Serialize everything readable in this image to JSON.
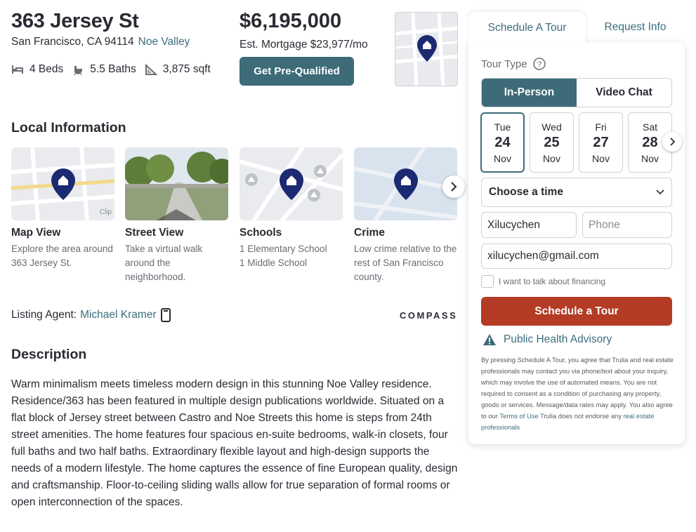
{
  "listing": {
    "street": "363 Jersey St",
    "city_state_zip": "San Francisco, CA 94114",
    "neighborhood": "Noe Valley",
    "beds": "4 Beds",
    "baths": "5.5 Baths",
    "sqft": "3,875 sqft",
    "price": "$6,195,000",
    "mortgage": "Est. Mortgage $23,977/mo",
    "prequal_button": "Get Pre-Qualified"
  },
  "local_info": {
    "heading": "Local Information",
    "map_clip_label": "Clip",
    "cards": [
      {
        "title": "Map View",
        "desc": "Explore the area around 363 Jersey St."
      },
      {
        "title": "Street View",
        "desc": "Take a virtual walk around the neighborhood."
      },
      {
        "title": "Schools",
        "desc": "1 Elementary School\n1 Middle School"
      },
      {
        "title": "Crime",
        "desc": "Low crime relative to the rest of San Francisco county."
      }
    ]
  },
  "agent": {
    "label": "Listing Agent:",
    "name": "Michael Kramer",
    "brokerage": "COMPASS"
  },
  "description": {
    "heading": "Description",
    "text": "Warm minimalism meets timeless modern design in this stunning Noe Valley residence. Residence/363 has been featured in multiple design publications worldwide. Situated on a flat block of Jersey street between Castro and Noe Streets this home is steps from 24th street amenities. The home features four spacious en-suite bedrooms, walk-in closets, four full baths and two half baths. Extraordinary flexible layout and high-design supports the needs of a modern lifestyle. The home captures the essence of fine European quality, design and craftsmanship. Floor-to-ceiling sliding walls allow for true separation of formal rooms or open interconnection of the spaces."
  },
  "tour": {
    "tabs": [
      "Schedule A Tour",
      "Request Info"
    ],
    "tour_type_label": "Tour Type",
    "type_options": [
      "In-Person",
      "Video Chat"
    ],
    "days": [
      {
        "dow": "Tue",
        "num": "24",
        "mon": "Nov"
      },
      {
        "dow": "Wed",
        "num": "25",
        "mon": "Nov"
      },
      {
        "dow": "Fri",
        "num": "27",
        "mon": "Nov"
      },
      {
        "dow": "Sat",
        "num": "28",
        "mon": "Nov"
      }
    ],
    "time_select": "Choose a time",
    "name_value": "Xilucychen",
    "phone_placeholder": "Phone",
    "email_value": "xilucychen@gmail.com",
    "financing_label": "I want to talk about financing",
    "cta": "Schedule a Tour",
    "advisory": "Public Health Advisory",
    "legal_1": "By pressing Schedule A Tour, you agree that Trulia and real estate professionals may contact you via phone/text about your inquiry, which may involve the use of automated means. You are not required to consent as a condition of purchasing any property, goods or services. Message/data rates may apply. You also agree to our",
    "legal_terms": "Terms of Use",
    "legal_2": "Trulia does not endorse any",
    "legal_pros": "real estate professionals"
  },
  "colors": {
    "accent_teal": "#3d6b78",
    "link": "#3b6e7f",
    "cta_red": "#b43b24",
    "pin_navy": "#1b2a72"
  }
}
